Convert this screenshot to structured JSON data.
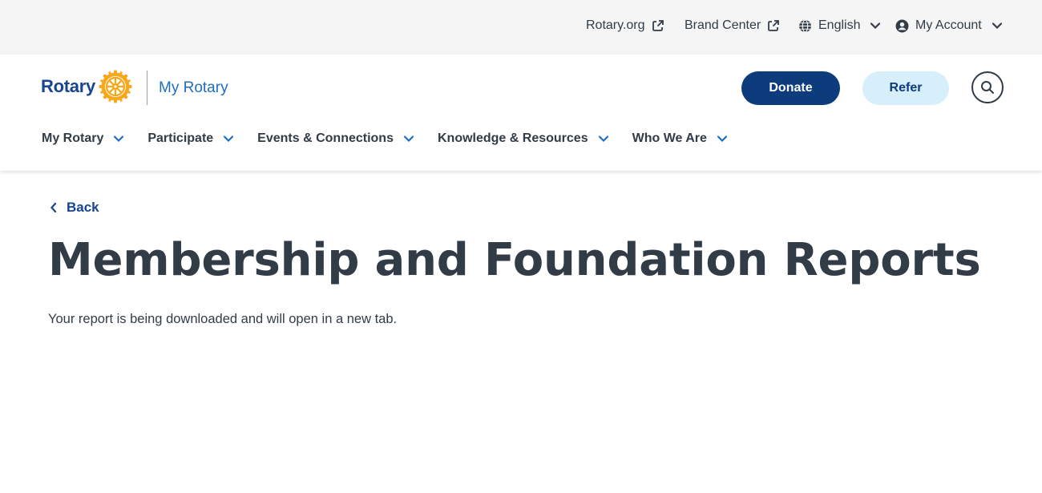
{
  "utility": {
    "rotary_org": "Rotary.org",
    "brand_center": "Brand Center",
    "language": "English",
    "account": "My Account"
  },
  "header": {
    "logo_text": "Rotary",
    "site_name": "My Rotary",
    "donate_label": "Donate",
    "refer_label": "Refer"
  },
  "nav": {
    "items": [
      {
        "label": "My Rotary"
      },
      {
        "label": "Participate"
      },
      {
        "label": "Events & Connections"
      },
      {
        "label": "Knowledge & Resources"
      },
      {
        "label": "Who We Are"
      }
    ]
  },
  "main": {
    "back_label": "Back",
    "title": "Membership and Foundation Reports",
    "status_message": "Your report is being downloaded and will open in a new tab."
  },
  "colors": {
    "brand_blue": "#17458f",
    "brand_gold": "#f7a81b",
    "donate_bg": "#0c3c7c",
    "refer_bg": "#d6effa",
    "link_blue": "#1f6ec2"
  }
}
